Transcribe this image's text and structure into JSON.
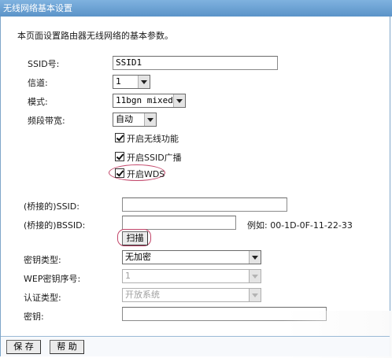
{
  "window": {
    "title": "无线网络基本设置"
  },
  "intro": "本页面设置路由器无线网络的基本参数。",
  "fields": {
    "ssid": {
      "label": "SSID号:",
      "value": "SSID1"
    },
    "channel": {
      "label": "信道:",
      "value": "1"
    },
    "mode": {
      "label": "模式:",
      "value": "11bgn mixed"
    },
    "bandwidth": {
      "label": "频段带宽:",
      "value": "自动"
    }
  },
  "checkboxes": {
    "enable_wireless": {
      "label": "开启无线功能",
      "checked": true
    },
    "enable_ssid_broadcast": {
      "label": "开启SSID广播",
      "checked": true
    },
    "enable_wds": {
      "label": "开启WDS",
      "checked": true
    }
  },
  "wds": {
    "bridge_ssid": {
      "label": "(桥接的)SSID:",
      "value": ""
    },
    "bridge_bssid": {
      "label": "(桥接的)BSSID:",
      "value": ""
    },
    "bssid_example": "例如: 00-1D-0F-11-22-33",
    "scan_button": "扫描",
    "key_type": {
      "label": "密钥类型:",
      "value": "无加密"
    },
    "wep_index": {
      "label": "WEP密钥序号:",
      "value": "1"
    },
    "auth_type": {
      "label": "认证类型:",
      "value": "开放系统"
    },
    "key": {
      "label": "密钥:",
      "value": ""
    }
  },
  "actions": {
    "save": "保 存",
    "help": "帮 助"
  },
  "colors": {
    "titlebar": "#6aa0d3",
    "highlight": "#c2466a",
    "frame": "#7fa6c9"
  }
}
